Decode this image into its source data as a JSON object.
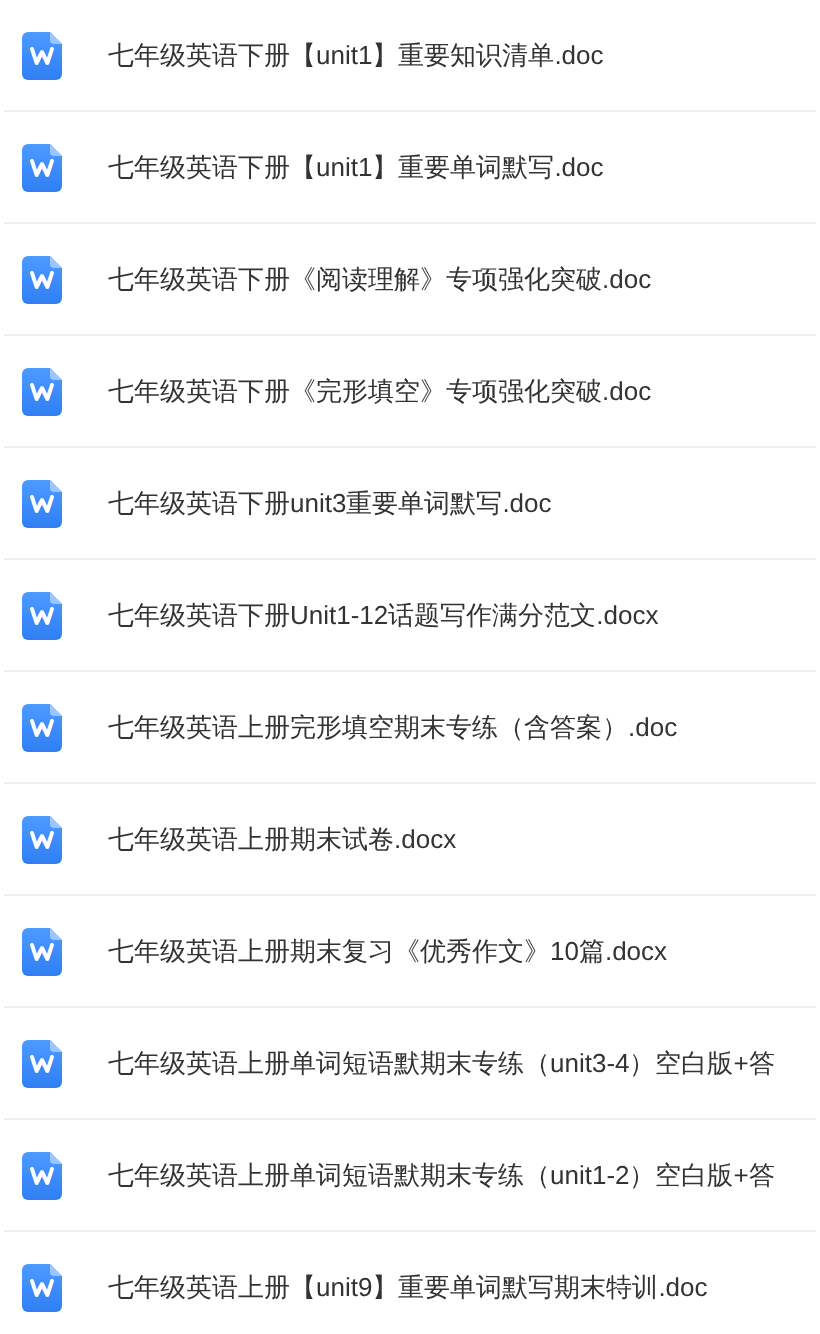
{
  "files": [
    {
      "name": "七年级英语下册【unit1】重要知识清单.doc",
      "kind": "word"
    },
    {
      "name": "七年级英语下册【unit1】重要单词默写.doc",
      "kind": "word"
    },
    {
      "name": "七年级英语下册《阅读理解》专项强化突破.doc",
      "kind": "word"
    },
    {
      "name": "七年级英语下册《完形填空》专项强化突破.doc",
      "kind": "word"
    },
    {
      "name": "七年级英语下册unit3重要单词默写.doc",
      "kind": "word"
    },
    {
      "name": "七年级英语下册Unit1-12话题写作满分范文.docx",
      "kind": "word"
    },
    {
      "name": "七年级英语上册完形填空期末专练（含答案）.doc",
      "kind": "word"
    },
    {
      "name": "七年级英语上册期末试卷.docx",
      "kind": "word"
    },
    {
      "name": "七年级英语上册期末复习《优秀作文》10篇.docx",
      "kind": "word"
    },
    {
      "name": "七年级英语上册单词短语默期末专练（unit3-4）空白版+答",
      "kind": "word"
    },
    {
      "name": "七年级英语上册单词短语默期末专练（unit1-2）空白版+答",
      "kind": "word"
    },
    {
      "name": "七年级英语上册【unit9】重要单词默写期末特训.doc",
      "kind": "word"
    }
  ]
}
